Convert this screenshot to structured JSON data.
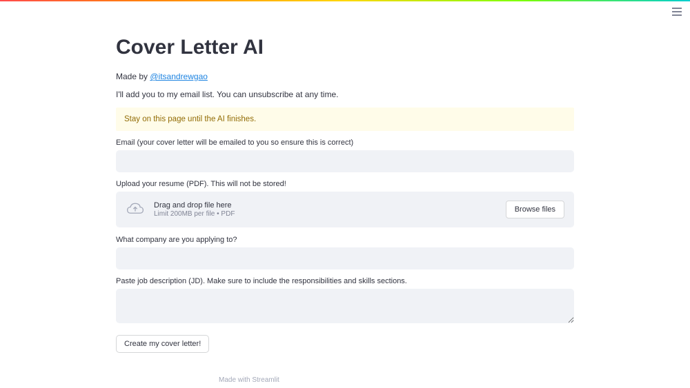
{
  "header": {
    "title": "Cover Letter AI"
  },
  "byline": {
    "prefix": "Made by ",
    "author_handle": "@itsandrewgao"
  },
  "subtext": "I'll add you to my email list. You can unsubscribe at any time.",
  "warning": "Stay on this page until the AI finishes.",
  "fields": {
    "email": {
      "label": "Email (your cover letter will be emailed to you so ensure this is correct)",
      "value": ""
    },
    "upload": {
      "label": "Upload your resume (PDF). This will not be stored!",
      "drag_text": "Drag and drop file here",
      "limit_text": "Limit 200MB per file • PDF",
      "browse_label": "Browse files"
    },
    "company": {
      "label": "What company are you applying to?",
      "value": ""
    },
    "jd": {
      "label": "Paste job description (JD). Make sure to include the responsibilities and skills sections.",
      "value": ""
    }
  },
  "submit": {
    "label": "Create my cover letter!"
  },
  "footer": {
    "prefix": "Made with ",
    "link_text": "Streamlit"
  }
}
